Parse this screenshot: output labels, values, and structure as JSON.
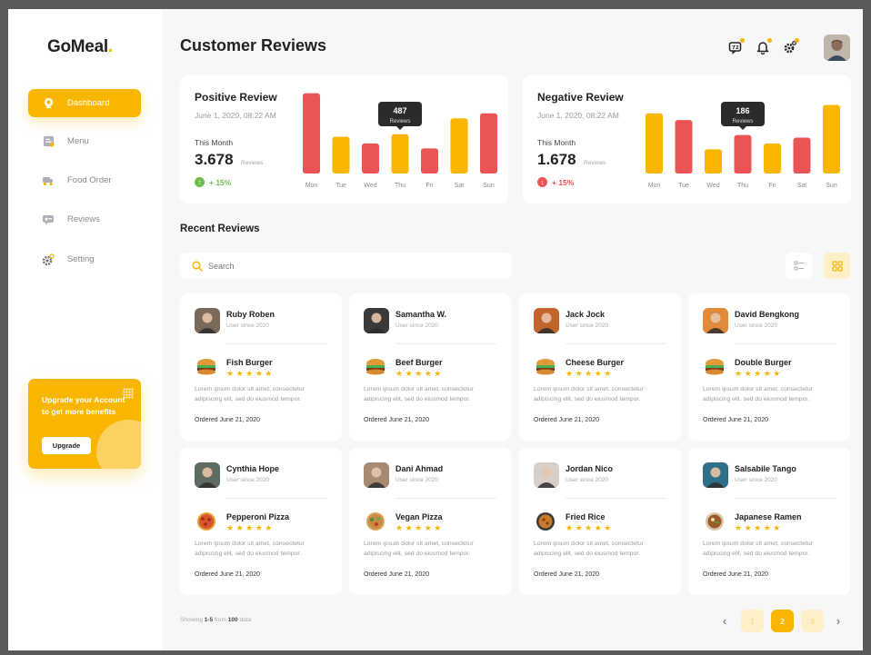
{
  "app": {
    "logo": "GoMeal",
    "logo_dot": "."
  },
  "sidebar": {
    "items": [
      {
        "label": "Dashboard",
        "icon": "dashboard-icon",
        "active": true
      },
      {
        "label": "Menu",
        "icon": "menu-icon"
      },
      {
        "label": "Food Order",
        "icon": "food-order-icon"
      },
      {
        "label": "Reviews",
        "icon": "reviews-icon"
      },
      {
        "label": "Setting",
        "icon": "setting-icon"
      }
    ],
    "upgrade": {
      "text": "Upgrade your Account to get more benefits",
      "button": "Upgrade"
    }
  },
  "header": {
    "title": "Customer Reviews"
  },
  "colors": {
    "accent": "#f8b600",
    "negative": "#ea5455",
    "positive": "#6bbf4e"
  },
  "positive": {
    "title": "Positive Review",
    "date": "June 1, 2020, 08:22 AM",
    "period": "This Month",
    "value": "3.678",
    "unit": "Reviews",
    "change": "+ 15%"
  },
  "negative": {
    "title": "Negative Review",
    "date": "June 1, 2020, 08:22 AM",
    "period": "This Month",
    "value": "1.678",
    "unit": "Reviews",
    "change": "+ 15%"
  },
  "chart_data": [
    {
      "type": "bar",
      "title": "Positive Review",
      "categories": [
        "Mon",
        "Tue",
        "Wed",
        "Thu",
        "Fri",
        "Sat",
        "Sun"
      ],
      "values": [
        480,
        220,
        180,
        235,
        150,
        330,
        360
      ],
      "bar_colors": [
        "#ea5455",
        "#f8b600",
        "#ea5455",
        "#f8b600",
        "#ea5455",
        "#f8b600",
        "#ea5455"
      ],
      "tooltip": {
        "category": "Thu",
        "value": "487",
        "label": "Reviews"
      }
    },
    {
      "type": "bar",
      "title": "Negative Review",
      "categories": [
        "Mon",
        "Tue",
        "Wed",
        "Thu",
        "Fri",
        "Sat",
        "Sun"
      ],
      "values": [
        360,
        320,
        145,
        230,
        180,
        215,
        410
      ],
      "bar_colors": [
        "#f8b600",
        "#ea5455",
        "#f8b600",
        "#ea5455",
        "#f8b600",
        "#ea5455",
        "#f8b600"
      ],
      "tooltip": {
        "category": "Thu",
        "value": "186",
        "label": "Reviews"
      }
    }
  ],
  "recent": {
    "title": "Recent Reviews",
    "search_placeholder": "Search",
    "reviews": [
      {
        "name": "Ruby Roben",
        "since": "User since 2020",
        "dish": "Fish Burger",
        "stars": "★★★★★",
        "desc": "Lorem ipsum dolor sit amet, consectetur adipiscing elit, sed do eiusmod tempor.",
        "ordered": "Ordered June 21, 2020",
        "avatar_color": "#7a6a5c",
        "food": "burger"
      },
      {
        "name": "Samantha W.",
        "since": "User since 2020",
        "dish": "Beef Burger",
        "stars": "★★★★★",
        "desc": "Lorem ipsum dolor sit amet, consectetur adipiscing elit, sed do eiusmod tempor.",
        "ordered": "Ordered June 21, 2020",
        "avatar_color": "#3a3a3a",
        "food": "burger"
      },
      {
        "name": "Jack Jock",
        "since": "User since 2020",
        "dish": "Cheese Burger",
        "stars": "★★★★★",
        "desc": "Lorem ipsum dolor sit amet, consectetur adipiscing elit, sed do eiusmod tempor.",
        "ordered": "Ordered June 21, 2020",
        "avatar_color": "#c2622d",
        "food": "burger"
      },
      {
        "name": "David Bengkong",
        "since": "User since 2020",
        "dish": "Double Burger",
        "stars": "★★★★★",
        "desc": "Lorem ipsum dolor sit amet, consectetur adipiscing elit, sed do eiusmod tempor.",
        "ordered": "Ordered June 21, 2020",
        "avatar_color": "#e08a3a",
        "food": "burger"
      },
      {
        "name": "Cynthia Hope",
        "since": "User since 2020",
        "dish": "Pepperoni Pizza",
        "stars": "★★★★★",
        "desc": "Lorem ipsum dolor sit amet, consectetur adipiscing elit, sed do eiusmod tempor.",
        "ordered": "Ordered June 21, 2020",
        "avatar_color": "#5d6b60",
        "food": "pizza"
      },
      {
        "name": "Dani Ahmad",
        "since": "User since 2020",
        "dish": "Vegan Pizza",
        "stars": "★★★★★",
        "desc": "Lorem ipsum dolor sit amet, consectetur adipiscing elit, sed do eiusmod tempor.",
        "ordered": "Ordered June 21, 2020",
        "avatar_color": "#a88a72",
        "food": "vegan"
      },
      {
        "name": "Jordan Nico",
        "since": "User since 2020",
        "dish": "Fried Rice",
        "stars": "★★★★★",
        "desc": "Lorem ipsum dolor sit amet, consectetur adipiscing elit, sed do eiusmod tempor.",
        "ordered": "Ordered June 21, 2020",
        "avatar_color": "#d8cfc8",
        "food": "rice"
      },
      {
        "name": "Salsabile Tango",
        "since": "User since 2020",
        "dish": "Japanese Ramen",
        "stars": "★★★★★",
        "desc": "Lorem ipsum dolor sit amet, consectetur adipiscing elit, sed do eiusmod tempor.",
        "ordered": "Ordered June 21, 2020",
        "avatar_color": "#2f6f8a",
        "food": "ramen"
      }
    ]
  },
  "footer": {
    "showing_prefix": "Showing ",
    "showing_range": "1-5",
    "showing_mid": " from ",
    "showing_total": "100",
    "showing_suffix": " data",
    "pages": [
      "1",
      "2",
      "3"
    ],
    "active_page": "2",
    "prev": "‹",
    "next": "›"
  }
}
